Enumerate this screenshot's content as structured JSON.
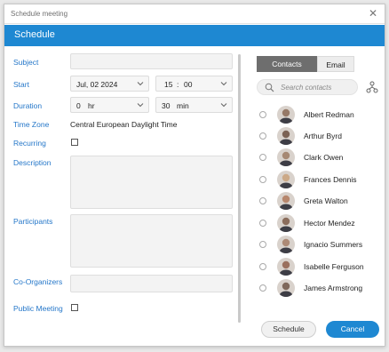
{
  "window": {
    "title": "Schedule meeting",
    "close_glyph": "✕"
  },
  "header": {
    "title": "Schedule"
  },
  "form": {
    "subject_label": "Subject",
    "start_label": "Start",
    "start_date": "Jul, 02 2024",
    "start_hour": "15",
    "start_sep": ":",
    "start_min": "00",
    "duration_label": "Duration",
    "duration_hours": "0",
    "duration_hours_unit": "hr",
    "duration_minutes": "30",
    "duration_minutes_unit": "min",
    "timezone_label": "Time Zone",
    "timezone_value": "Central European Daylight Time",
    "recurring_label": "Recurring",
    "description_label": "Description",
    "participants_label": "Participants",
    "coorganizers_label": "Co-Organizers",
    "public_label": "Public Meeting"
  },
  "tabs": {
    "contacts": "Contacts",
    "email": "Email"
  },
  "search": {
    "placeholder": "Search contacts"
  },
  "contacts": [
    {
      "name": "Albert Redman",
      "color": "#8a6a55"
    },
    {
      "name": "Arthur Byrd",
      "color": "#6b4f3e"
    },
    {
      "name": "Clark Owen",
      "color": "#9c7b63"
    },
    {
      "name": "Frances Dennis",
      "color": "#c9a27a"
    },
    {
      "name": "Greta Walton",
      "color": "#b07a5c"
    },
    {
      "name": "Hector Mendez",
      "color": "#7d5c48"
    },
    {
      "name": "Ignacio Summers",
      "color": "#a57e66"
    },
    {
      "name": "Isabelle Ferguson",
      "color": "#8e5f4a"
    },
    {
      "name": "James Armstrong",
      "color": "#6f5646"
    }
  ],
  "buttons": {
    "schedule": "Schedule",
    "cancel": "Cancel"
  },
  "colors": {
    "accent": "#1e88d2",
    "label": "#2577c9"
  }
}
